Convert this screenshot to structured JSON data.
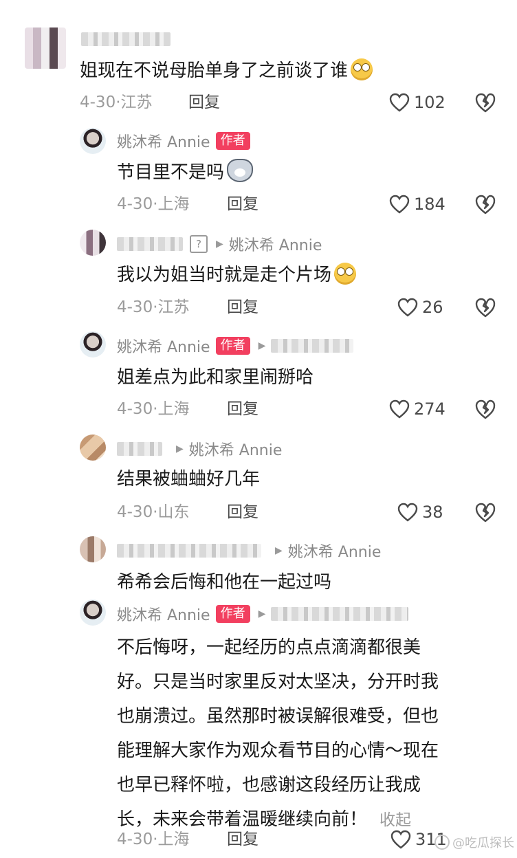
{
  "comments": [
    {
      "user": "",
      "text": "姐现在不说母胎单身了之前谈了谁",
      "emoji": "face-with-rolling-eyes",
      "date": "4-30",
      "location": "江苏",
      "reply_label": "回复",
      "likes": "102"
    },
    {
      "user": "姚沐希 Annie",
      "tag": "作者",
      "text": "节目里不是吗",
      "emoji": "husky-dog-face",
      "date": "4-30",
      "location": "上海",
      "reply_label": "回复",
      "likes": "184"
    },
    {
      "user": "",
      "reply_to": "姚沐希 Annie",
      "text": "我以为姐当时就是走个片场",
      "emoji": "face-with-rolling-eyes",
      "date": "4-30",
      "location": "江苏",
      "reply_label": "回复",
      "likes": "26"
    },
    {
      "user": "姚沐希 Annie",
      "tag": "作者",
      "text": "姐差点为此和家里闹掰哈",
      "date": "4-30",
      "location": "上海",
      "reply_label": "回复",
      "likes": "274"
    },
    {
      "user": "",
      "reply_to": "姚沐希 Annie",
      "text": "结果被蛐蛐好几年",
      "date": "4-30",
      "location": "山东",
      "reply_label": "回复",
      "likes": "38"
    },
    {
      "user": "",
      "reply_to": "姚沐希 Annie",
      "text": "希希会后悔和他在一起过吗"
    },
    {
      "user": "姚沐希 Annie",
      "tag": "作者",
      "text_lines": [
        "不后悔呀，一起经历的点点滴滴都很美",
        "好。只是当时家里反对太坚决，分开时我",
        "也崩溃过。虽然那时被误解很难受，但也",
        "能理解大家作为观众看节目的心情～现在",
        "也早已释怀啦，也感谢这段经历让我成",
        "长，未来会带着温暖继续向前！"
      ],
      "collapse_label": "收起",
      "date": "4-30",
      "location": "上海",
      "reply_label": "回复",
      "likes": "311"
    }
  ],
  "date_separator": "·",
  "watermark": "@吃瓜探长",
  "colors": {
    "author_tag": "#f23f5f",
    "meta_text": "#9b9b9b",
    "body_text": "#1a1a1a"
  }
}
